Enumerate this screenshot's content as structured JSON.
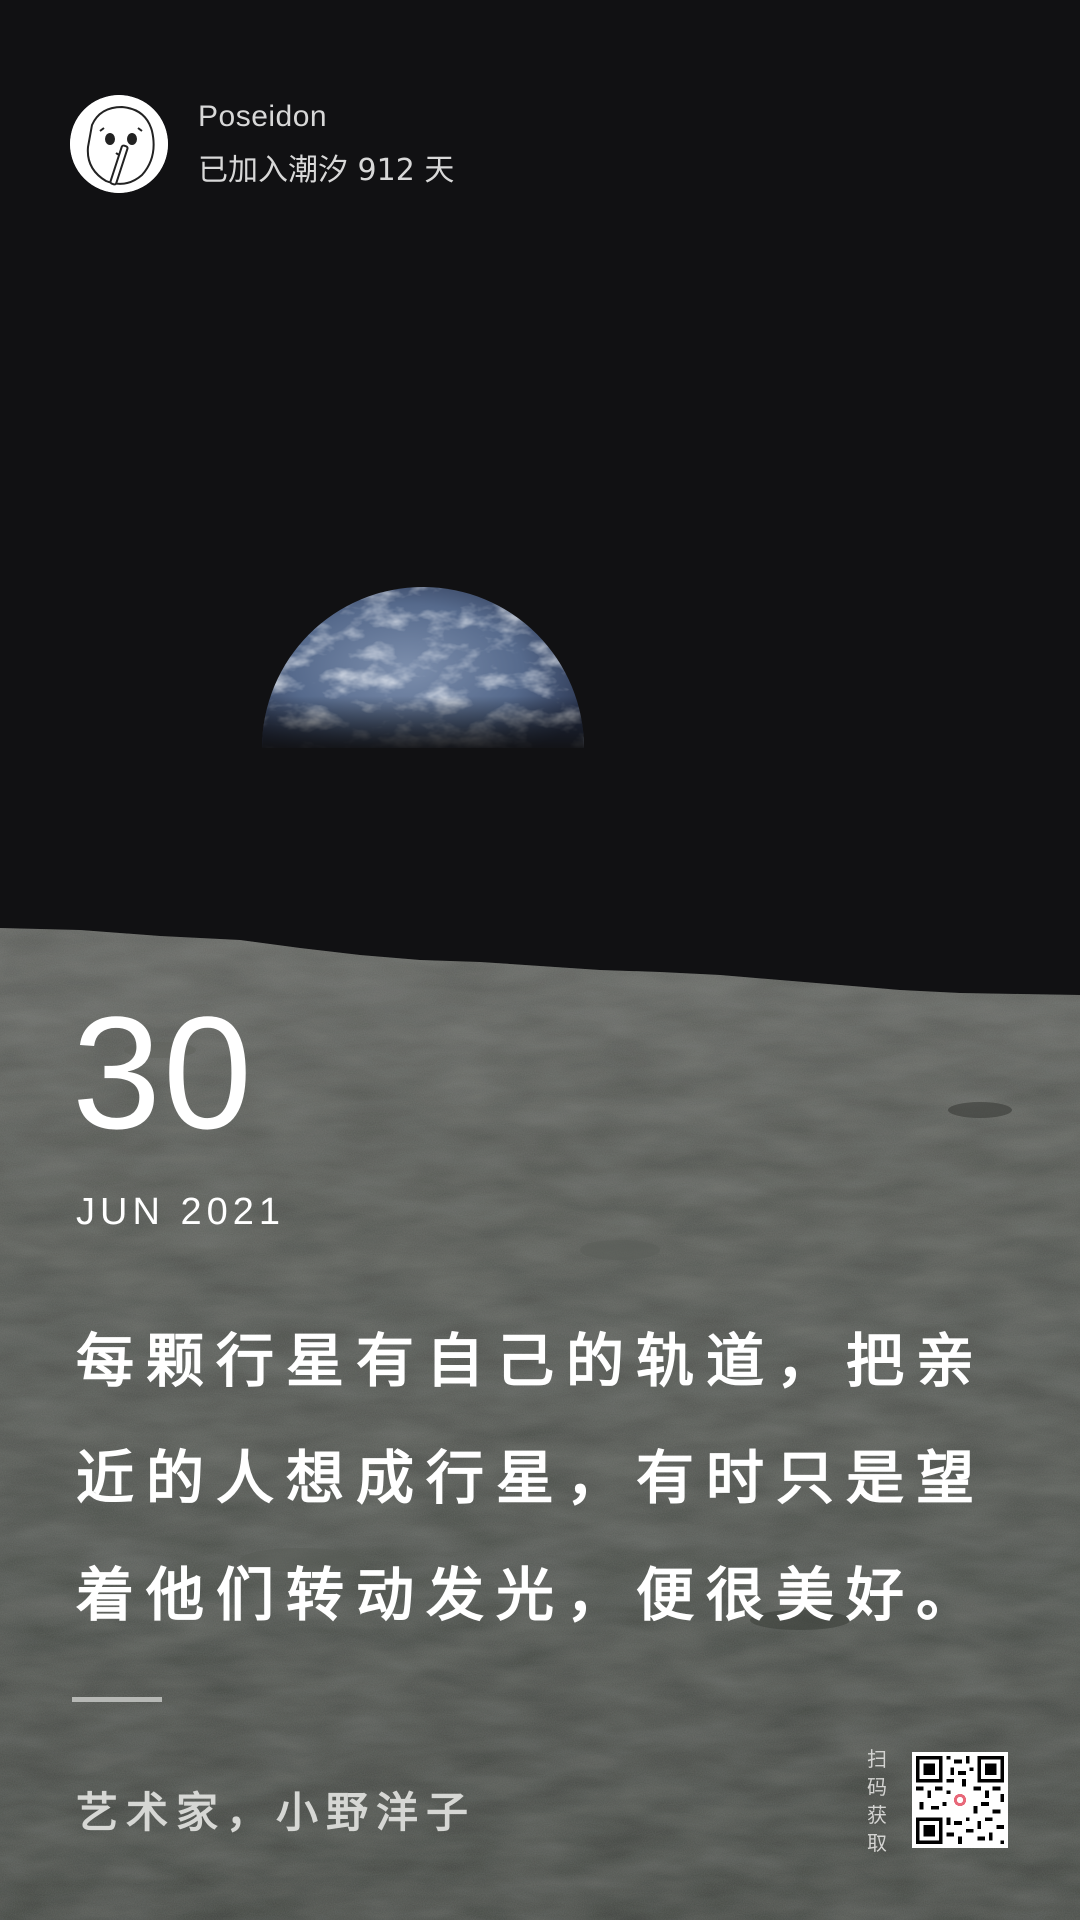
{
  "header": {
    "username": "Poseidon",
    "joined_text": "已加入潮汐 912 天"
  },
  "date": {
    "day": "30",
    "month_year": "JUN 2021"
  },
  "quote": {
    "lines": [
      "每颗行星有自己的轨道，把亲",
      "近的人想成行星，有时只是望",
      "着他们转动发光，便很美好。"
    ]
  },
  "author": "艺术家，小野洋子",
  "qr": {
    "label": "扫码获取"
  },
  "colors": {
    "sky": "#111113",
    "moon_surface": "#4a4d48",
    "text": "#ffffff",
    "earth": "#5b6f8f"
  },
  "icons": {
    "avatar": "cartoon-face-avatar",
    "qr": "qr-code-icon"
  }
}
